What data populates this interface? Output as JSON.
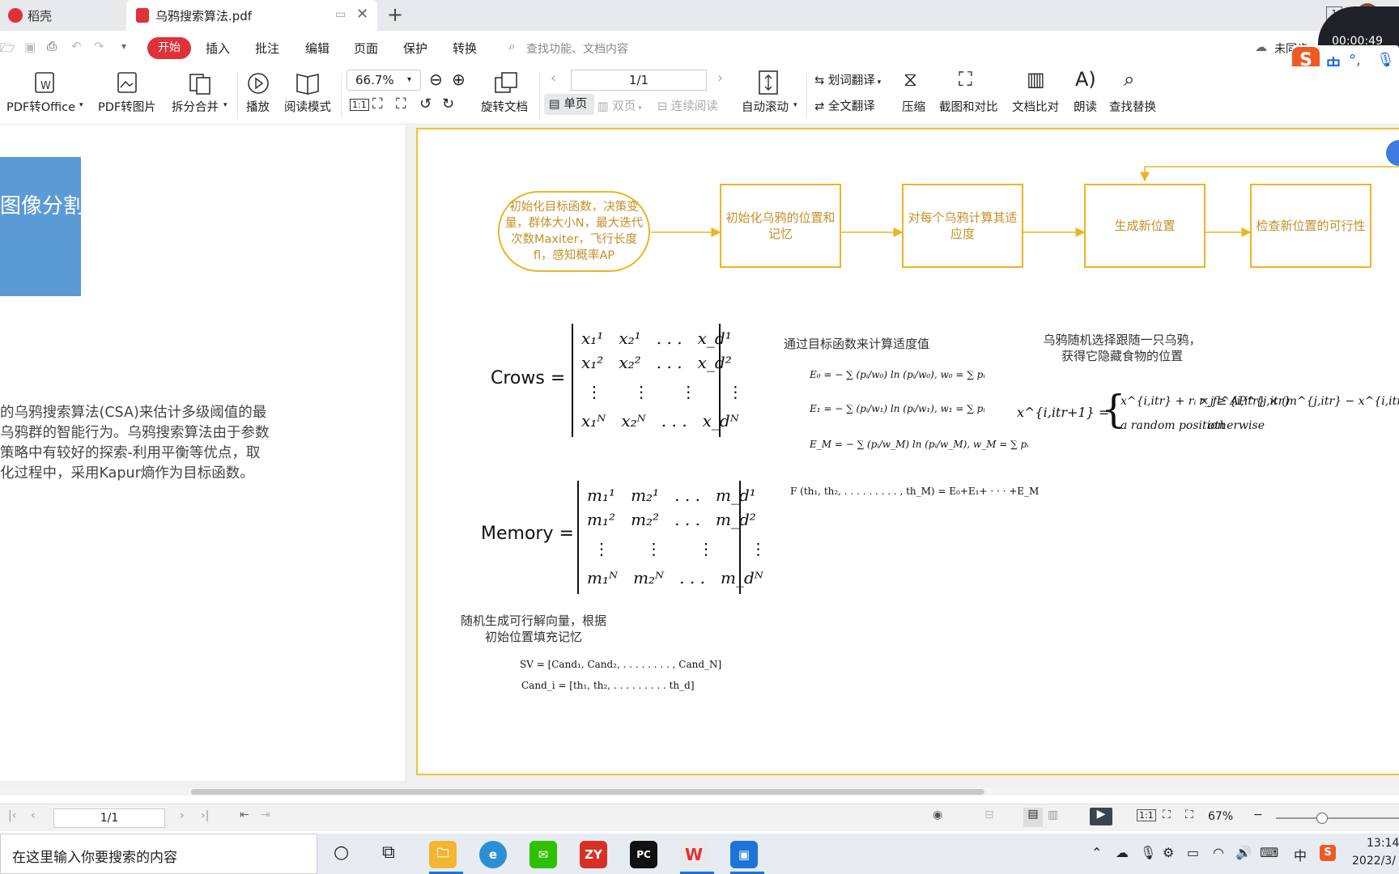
{
  "tabs": [
    {
      "label": "稻壳"
    },
    {
      "label": "乌鸦搜索算法.pdf"
    }
  ],
  "menu": {
    "start": "开始",
    "items": [
      "插入",
      "批注",
      "编辑",
      "页面",
      "保护",
      "转换"
    ],
    "search_placeholder": "查找功能、文档内容",
    "cloud_status": "未同步"
  },
  "recording": {
    "time": "00:00:49"
  },
  "toolbar": {
    "pdf_to_office": "PDF转Office",
    "pdf_to_image": "PDF转图片",
    "split_merge": "拆分合并",
    "play": "播放",
    "read_mode": "阅读模式",
    "zoom": "66.7%",
    "rotate": "旋转文档",
    "single_page": "单页",
    "double_page": "双页",
    "continuous": "连续阅读",
    "page_value": "1/1",
    "auto_scroll": "自动滚动",
    "word_translate": "划词翻译",
    "full_translate": "全文翻译",
    "compress": "压缩",
    "screenshot_compare": "截图和对比",
    "doc_compare": "文档比对",
    "read_aloud": "朗读",
    "find_replace": "查找替换"
  },
  "ime": {
    "lang": "中"
  },
  "left_page": {
    "banner_text": "图像分割",
    "paragraph": [
      "的乌鸦搜索算法(CSA)来估计多级阈值的最",
      "乌鸦群的智能行为。乌鸦搜索算法由于参数",
      "策略中有较好的探索-利用平衡等优点，取",
      "化过程中，采用Kapur熵作为目标函数。"
    ]
  },
  "flow": {
    "init_objective": "初始化目标函数，决策变量，群体大小N，最大迭代次数Maxiter，飞行长度fl，感知概率AP",
    "init_position": "初始化乌鸦的位置和记忆",
    "fitness": "对每个乌鸦计算其适应度",
    "new_position": "生成新位置",
    "check_feasible": "检查新位置的可行性",
    "fitness_caption": "通过目标函数来计算适度值",
    "follow_caption": "乌鸦随机选择跟随一只乌鸦，获得它隐藏食物的位置",
    "memory_caption": "随机生成可行解向量，根据初始位置填充记忆",
    "crows_label": "Crows =",
    "memory_label": "Memory =",
    "sv_formula": "SV = [Cand₁, Cand₂, . . . . . . . . , Cand_N]",
    "cand_formula": "Cand_i = [th₁, th₂, . . . . . . . . . th_d]",
    "f_formula": "F (th₁, th₂, . . . . . . . . . , th_M) = E₀+E₁+ · · · +E_M",
    "update_rand": "a random position",
    "update_otherwise": "otherwise",
    "update_cond": "r_j ≥ AP^{j,itr}"
  },
  "statusbar": {
    "page": "1/1",
    "zoom": "67%"
  },
  "taskbar": {
    "search_placeholder": "在这里输入你要搜索的内容",
    "time": "13:14",
    "date": "2022/3/",
    "ime": "中"
  }
}
